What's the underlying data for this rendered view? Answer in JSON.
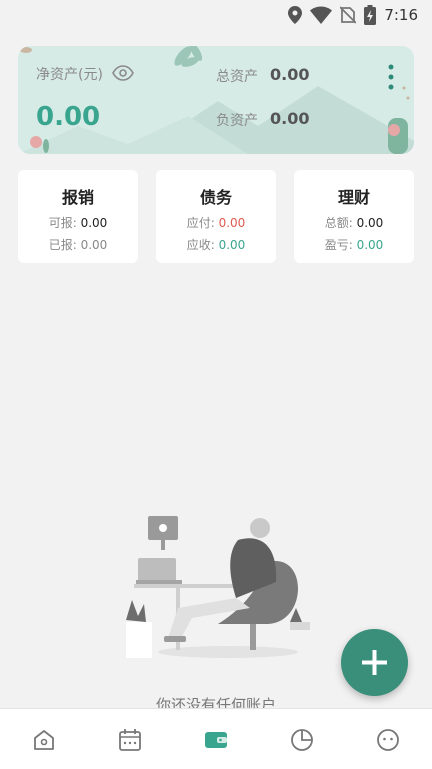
{
  "status_bar": {
    "time": "7:16",
    "icons": [
      "location-icon",
      "wifi-icon",
      "no-sim-icon",
      "battery-charging-icon"
    ]
  },
  "asset_card": {
    "net_label": "净资产(元)",
    "net_value": "0.00",
    "total_label": "总资产",
    "total_value": "0.00",
    "debt_label": "负资产",
    "debt_value": "0.00",
    "colors": {
      "accent": "#3aa58e",
      "card_bg": "#d7ebe6"
    }
  },
  "cards": [
    {
      "title": "报销",
      "row1_label": "可报: ",
      "row1_value": "0.00",
      "row2_label": "已报: ",
      "row2_value": "0.00"
    },
    {
      "title": "债务",
      "row1_label": "应付: ",
      "row1_value": "0.00",
      "row2_label": "应收: ",
      "row2_value": "0.00"
    },
    {
      "title": "理财",
      "row1_label": "总额: ",
      "row1_value": "0.00",
      "row2_label": "盈亏: ",
      "row2_value": "0.00"
    }
  ],
  "empty_state": {
    "text": "你还没有任何账户"
  },
  "fab": {
    "icon": "plus-icon",
    "color": "#3a8f7a"
  },
  "bottom_nav": {
    "items": [
      "home-icon",
      "calendar-icon",
      "wallet-icon",
      "pie-chart-icon",
      "profile-icon"
    ],
    "active": "wallet-icon",
    "active_color": "#3aa58e"
  }
}
